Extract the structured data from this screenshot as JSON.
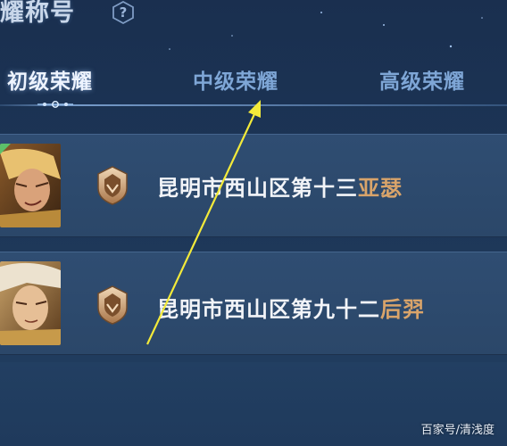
{
  "header": {
    "title": "耀称号",
    "help_icon": "help-question-icon"
  },
  "tabs": [
    {
      "label": "初级荣耀",
      "active": true
    },
    {
      "label": "中级荣耀",
      "active": false
    },
    {
      "label": "高级荣耀",
      "active": false
    }
  ],
  "rows": [
    {
      "title_prefix": "昆明市西山区第十三",
      "hero": "亚瑟",
      "avatar_icon": "hero-avatar-arthur",
      "badge_icon": "honor-badge-icon"
    },
    {
      "title_prefix": "昆明市西山区第九十二",
      "hero": "后羿",
      "avatar_icon": "hero-avatar-houyi",
      "badge_icon": "honor-badge-icon"
    }
  ],
  "watermark": "百家号/清浅度",
  "colors": {
    "background": "#1c3556",
    "row": "#2f4d72",
    "hero_name": "#d9a46a",
    "arrow": "#f3ea3a",
    "tab_active": "#eef4ff",
    "tab_inactive": "#7ea6d6"
  }
}
